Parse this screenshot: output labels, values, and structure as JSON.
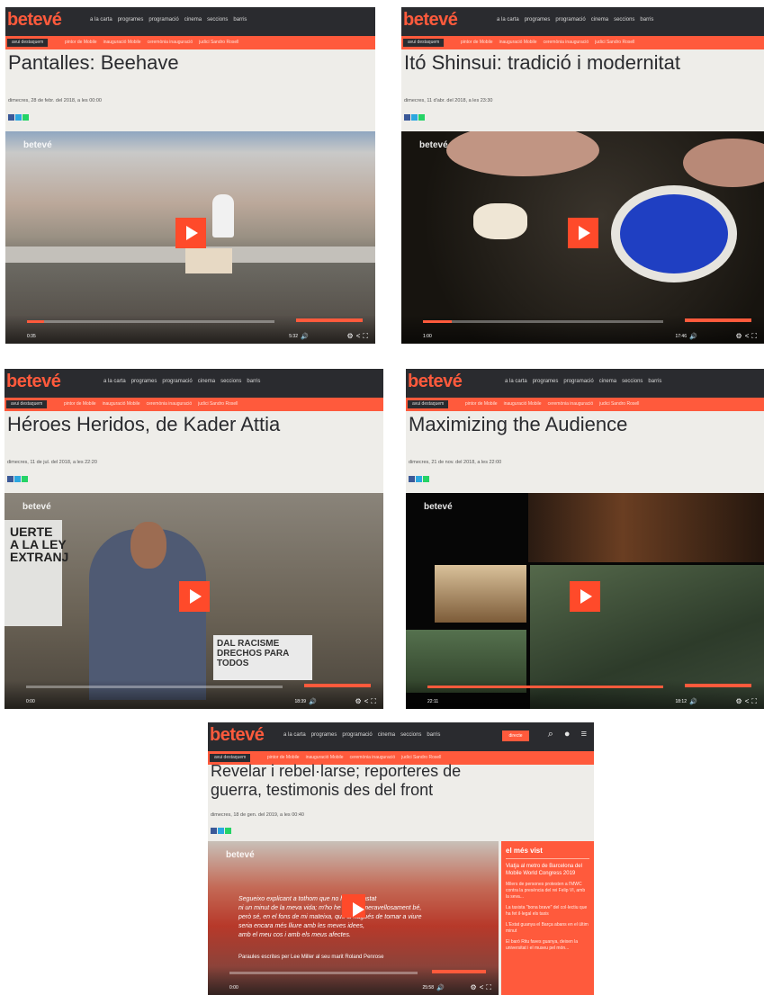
{
  "brand": {
    "logo": "betevé",
    "accent": "#ff5a3c",
    "dark": "#2a2b2f"
  },
  "nav": [
    "a la carta",
    "programes",
    "programació",
    "cinema",
    "seccions",
    "barris"
  ],
  "tags": {
    "live": "avui destaquem",
    "items": [
      "pintor de Mobile",
      "inauguració Mobile",
      "ceremònia inauguració",
      "judici Sandro Rosell"
    ]
  },
  "watermark": "betevé",
  "screens": [
    {
      "title": "Pantalles: Beehave",
      "date": "dimecres, 28 de febr. del 2018, a les 00:00",
      "time_current": "0:35",
      "time_total": "5:32",
      "progress": 0.07
    },
    {
      "title": "Itó Shinsui: tradició i modernitat",
      "date": "dimecres, 11 d'abr. del 2018, a les 23:30",
      "time_current": "1:00",
      "time_total": "17:46",
      "progress": 0.12
    },
    {
      "title": "Héroes Heridos, de Kader Attia",
      "date": "dimecres, 11 de jul. del 2018, a les 22:20",
      "time_current": "0:00",
      "time_total": "18:39",
      "progress": 0.0,
      "sign_text": "UERTE\nA LA LEY\nEXTRANJ",
      "banner_text": "DAL RACISME\nDRECHOS PARA\nTODOS"
    },
    {
      "title": "Maximizing the Audience",
      "date": "dimecres, 21 de nov. del 2018, a les 22:00",
      "time_current": "22:11",
      "time_total": "18:12",
      "progress": 1.0
    },
    {
      "title": "Revelar i rebel·larse; reporteres de guerra, testimonis des del front",
      "date": "dimecres, 18 de gen. del 2019, a les 00:40",
      "time_current": "0:00",
      "time_total": "25:58",
      "progress": 0.0,
      "poem": "Segueixo explicant a tothom que no he malgastat\nni un minut de la meva vida; m'ho he passat meravellosament bé,\nperò sé, en el fons de mi mateixa, que si hagués de tornar a viure\nseria encara més lliure amb les meves idees,\namb el meu cos i amb els meus afectes.",
      "caption": "Paraules escrites per Lee Miller al seu marit Roland Penrose",
      "button": "directe",
      "sidebar": {
        "title": "el més vist",
        "items": [
          "Viatja al metro de Barcelona del Mobile World Congress 2019",
          "Milers de persones protesten a l'MWC contra la presència del rei Felip VI, amb la seva...",
          "La taxista \"bona brave\" del col·lectiu que ha fet il·legal els taxis",
          "L'Estat guanya el Barça abans en el últim minut",
          "El baró Ritu faves guanya, deixen la universitat i el museu pel món..."
        ]
      }
    }
  ]
}
